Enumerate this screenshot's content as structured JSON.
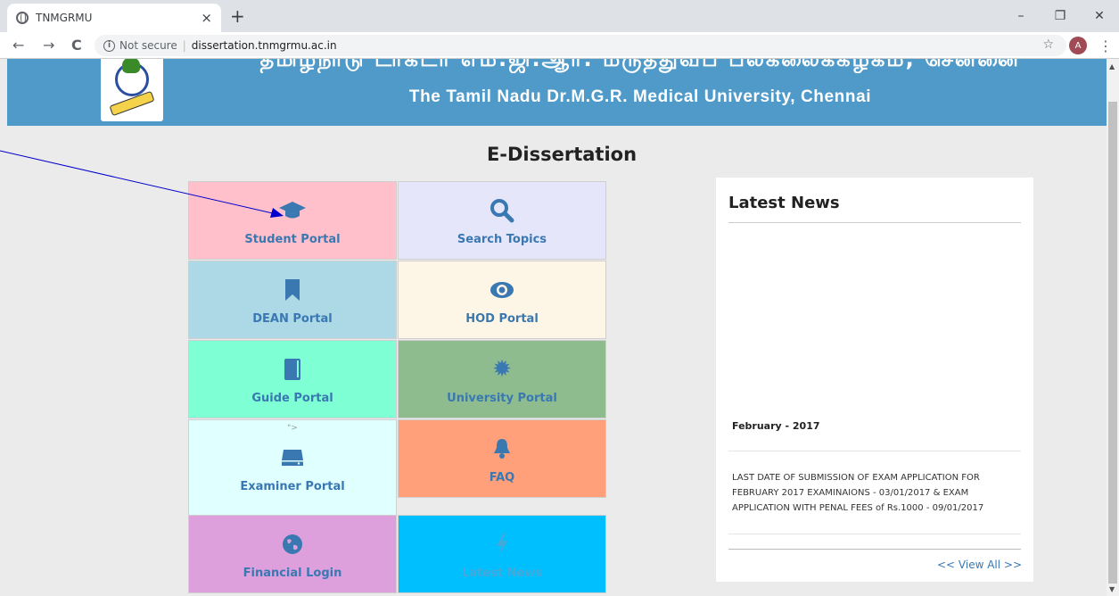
{
  "browser": {
    "tab_title": "TNMGRMU",
    "tab_close": "×",
    "new_tab": "+",
    "win_minimize": "–",
    "win_restore": "❐",
    "win_close": "✕",
    "back": "←",
    "forward": "→",
    "reload": "C",
    "info": "i",
    "security_text": "Not secure",
    "url": "dissertation.tnmgrmu.ac.in",
    "star": "☆",
    "profile_initial": "A",
    "menu": "⋮"
  },
  "banner": {
    "tamil_title": "தமிழ்நாடு டாக்டர் எம்.ஜி.ஆர். மருத்துவப் பல்கலைக்கழகம், சென்னை",
    "english_title": "The Tamil Nadu Dr.M.G.R. Medical University, Chennai"
  },
  "page": {
    "heading": "E-Dissertation"
  },
  "portals": [
    {
      "label": "Student Portal",
      "icon": "graduation-cap-icon",
      "glyph": "🎓",
      "bg": "#ffc0cb"
    },
    {
      "label": "Search Topics",
      "icon": "search-icon",
      "glyph": "⚲",
      "bg": "#e6e6fa"
    },
    {
      "label": "DEAN Portal",
      "icon": "bookmark-icon",
      "glyph": "▮",
      "bg": "#add8e6"
    },
    {
      "label": "HOD Portal",
      "icon": "eye-icon",
      "glyph": "◉",
      "bg": "#fdf5e6"
    },
    {
      "label": "Guide Portal",
      "icon": "book-icon",
      "glyph": "▮",
      "bg": "#7fffd4"
    },
    {
      "label": "University Portal",
      "icon": "certificate-icon",
      "glyph": "✹",
      "bg": "#8fbc8f"
    },
    {
      "label": "Examiner Portal",
      "icon": "hdd-icon",
      "glyph": "▬",
      "bg": "#e0ffff",
      "note": "\">"
    },
    {
      "label": "FAQ",
      "icon": "bell-icon",
      "glyph": "🔔",
      "bg": "#ffa07a"
    },
    {
      "label": "Financial Login",
      "icon": "globe-icon",
      "glyph": "🌍",
      "bg": "#dda0dd"
    },
    {
      "label": "Latest News",
      "icon": "bolt-icon",
      "glyph": "ϟ",
      "bg": "#00bfff"
    }
  ],
  "news": {
    "heading": "Latest News",
    "month": "February - 2017",
    "body": "LAST DATE OF SUBMISSION OF EXAM APPLICATION FOR FEBRUARY 2017 EXAMINAIONS - 03/01/2017 & EXAM APPLICATION WITH PENAL FEES of Rs.1000 - 09/01/2017",
    "view_all": "<< View All >>"
  },
  "colors": {
    "banner": "#4f9ac8",
    "link": "#3a78b2",
    "annotation_arrow": "#0000cc"
  }
}
